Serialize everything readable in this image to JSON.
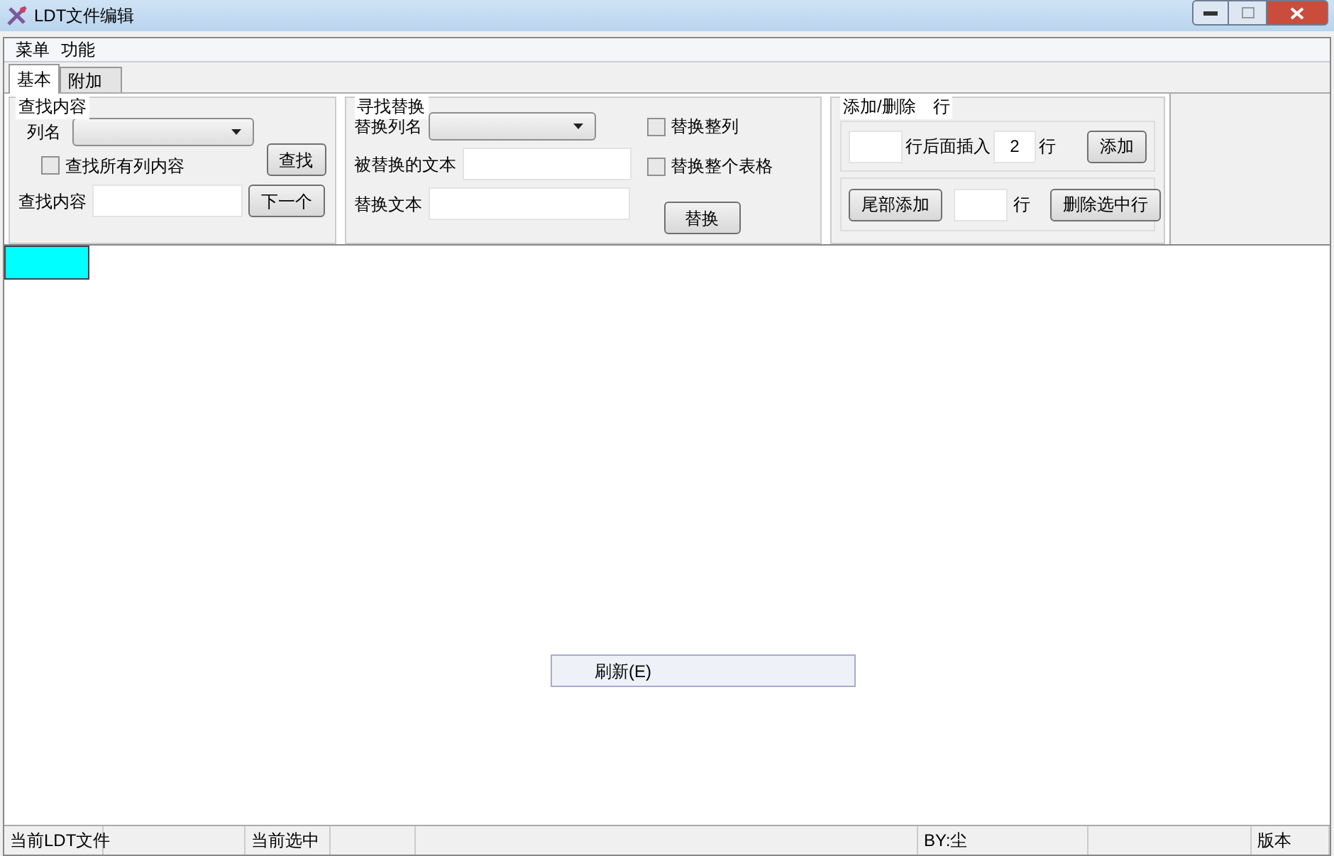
{
  "window": {
    "title": "LDT文件编辑"
  },
  "menu": [
    "菜单",
    "功能"
  ],
  "tabs": [
    {
      "label": "基本",
      "selected": true
    },
    {
      "label": "附加",
      "selected": false
    }
  ],
  "find": {
    "title": "查找内容",
    "column_label": "列名",
    "all_columns": {
      "label": "查找所有列内容",
      "checked": false
    },
    "find_button": "查找",
    "content_label": "查找内容",
    "next_button": "下一个"
  },
  "replace": {
    "title": "寻找替换",
    "column_label": "替换列名",
    "old_label": "被替换的文本",
    "new_label": "替换文本",
    "whole_column": {
      "label": "替换整列",
      "checked": false
    },
    "whole_table": {
      "label": "替换整个表格",
      "checked": false
    },
    "replace_button": "替换"
  },
  "rows": {
    "title": "添加/删除　行",
    "after_label": "行后面插入",
    "count": "2",
    "row_unit": "行",
    "add_button": "添加",
    "append_button": "尾部添加",
    "row_unit_2": "行",
    "delete_button": "删除选中行"
  },
  "context_menu": [
    "刷新(E)"
  ],
  "status_bar": [
    {
      "kind": "text",
      "text": "当前LDT文件"
    },
    {
      "kind": "blank"
    },
    {
      "kind": "text",
      "text": "当前选中"
    },
    {
      "kind": "blank"
    },
    {
      "kind": "blank"
    },
    {
      "kind": "text",
      "text": "BY:尘"
    },
    {
      "kind": "blank"
    },
    {
      "kind": "text",
      "text": "版本"
    }
  ]
}
